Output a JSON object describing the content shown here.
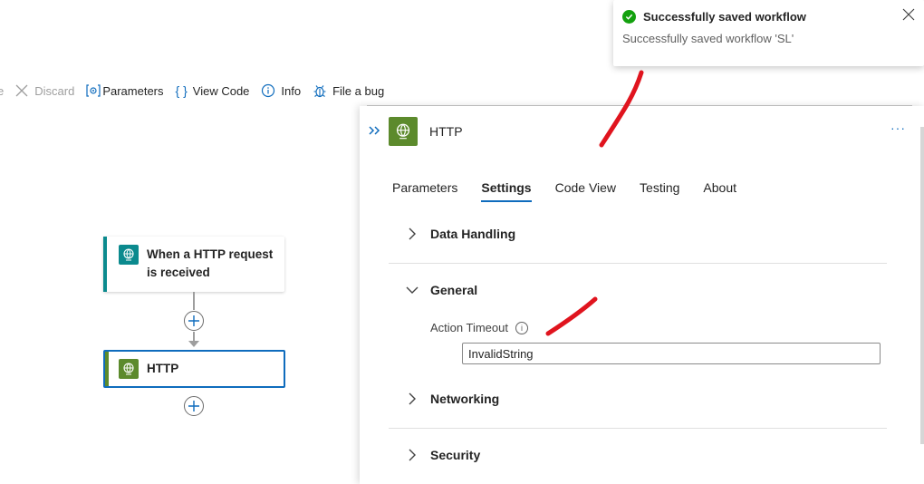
{
  "toolbar": {
    "cut_text": "e",
    "discard_label": "Discard",
    "parameters_label": "Parameters",
    "view_code_label": "View Code",
    "info_label": "Info",
    "file_bug_label": "File a bug"
  },
  "canvas": {
    "trigger_node": {
      "title_line1": "When a HTTP request",
      "title_line2": "is received"
    },
    "action_node": {
      "title": "HTTP"
    }
  },
  "panel": {
    "title": "HTTP",
    "more": "···",
    "tabs": [
      {
        "label": "Parameters"
      },
      {
        "label": "Settings",
        "active": true
      },
      {
        "label": "Code View"
      },
      {
        "label": "Testing"
      },
      {
        "label": "About"
      }
    ],
    "sections": {
      "data_handling": "Data Handling",
      "general": "General",
      "networking": "Networking",
      "security": "Security"
    },
    "action_timeout": {
      "label": "Action Timeout",
      "value": "InvalidString"
    }
  },
  "toast": {
    "title": "Successfully saved workflow",
    "body": "Successfully saved workflow 'SL'"
  },
  "colors": {
    "accent": "#0f6cbd",
    "http_green": "#5c8a2c",
    "request_teal": "#0b8a8e",
    "success": "#13a10e",
    "annotation_red": "#e0141e"
  }
}
